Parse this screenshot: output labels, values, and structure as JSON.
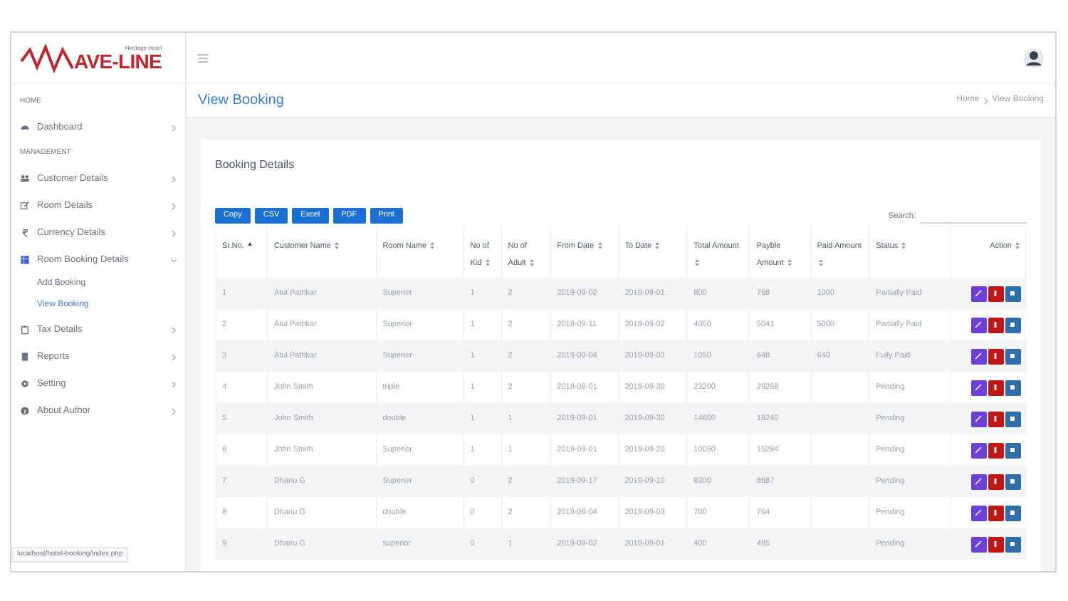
{
  "logo": {
    "text": "AVE-LINE",
    "tagline": "Heritage Hotel"
  },
  "sidebar": {
    "sections": [
      {
        "heading": "HOME",
        "items": [
          {
            "label": "Dashboard",
            "expanded": false
          }
        ]
      },
      {
        "heading": "MANAGEMENT",
        "items": [
          {
            "label": "Customer Details",
            "expanded": false
          },
          {
            "label": "Room Details",
            "expanded": false
          },
          {
            "label": "Currency Details",
            "expanded": false
          },
          {
            "label": "Room Booking Details",
            "expanded": true,
            "children": [
              {
                "label": "Add Booking",
                "selected": false
              },
              {
                "label": "View Booking",
                "selected": true
              }
            ]
          },
          {
            "label": "Tax Details",
            "expanded": false
          },
          {
            "label": "Reports",
            "expanded": false
          },
          {
            "label": "Setting",
            "expanded": false
          },
          {
            "label": "About Author",
            "expanded": false
          }
        ]
      }
    ]
  },
  "page_title": "View Booking",
  "breadcrumb": [
    "Home",
    "View Booking"
  ],
  "status_url": "localhost/hotel-booking/index.php",
  "card": {
    "title": "Booking Details",
    "export_buttons": [
      "Copy",
      "CSV",
      "Excel",
      "PDF",
      "Print"
    ],
    "search_label": "Search:",
    "table": {
      "columns": [
        {
          "label": "Sr.No.",
          "sorted": true
        },
        {
          "label": "Customer Name",
          "sorted": false
        },
        {
          "label": "Room Name",
          "sorted": false
        },
        {
          "label": "No of Kid",
          "sorted": false
        },
        {
          "label": "No of Adult",
          "sorted": false
        },
        {
          "label": "From Date",
          "sorted": false
        },
        {
          "label": "To Date",
          "sorted": false
        },
        {
          "label": "Total Amount",
          "sorted": false
        },
        {
          "label": "Payble Amount",
          "sorted": false
        },
        {
          "label": "Paid Amount",
          "sorted": false
        },
        {
          "label": "Status",
          "sorted": false
        },
        {
          "label": "Action",
          "sorted": false
        }
      ],
      "rows": [
        [
          "1",
          "Atul Pathkar",
          "Superior",
          "1",
          "2",
          "2019-09-02",
          "2019-09-01",
          "800",
          "768",
          "1000",
          "Partially Paid"
        ],
        [
          "2",
          "Atul Pathkar",
          "Superior",
          "1",
          "2",
          "2019-09-11",
          "2019-09-02",
          "4050",
          "5041",
          "5000",
          "Partially Paid"
        ],
        [
          "3",
          "Atul Pathkar",
          "Superior",
          "1",
          "2",
          "2019-09-04",
          "2019-09-03",
          "1050",
          "648",
          "640",
          "Fully Paid"
        ],
        [
          "4",
          "John Smith",
          "triple",
          "1",
          "2",
          "2019-09-01",
          "2019-09-30",
          "23200",
          "29268",
          "",
          "Pending"
        ],
        [
          "5",
          "John Smith",
          "double",
          "1",
          "1",
          "2019-09-01",
          "2019-09-30",
          "14600",
          "18240",
          "",
          "Pending"
        ],
        [
          "6",
          "John Smith",
          "Superior",
          "1",
          "1",
          "2019-09-01",
          "2019-09-20",
          "10050",
          "15284",
          "",
          "Pending"
        ],
        [
          "7",
          "Dhanu G",
          "Superior",
          "0",
          "2",
          "2019-09-17",
          "2019-09-10",
          "8300",
          "8687",
          "",
          "Pending"
        ],
        [
          "8",
          "Dhanu G",
          "double",
          "0",
          "2",
          "2019-09-04",
          "2019-09-03",
          "700",
          "764",
          "",
          "Pending"
        ],
        [
          "9",
          "Dhanu G",
          "superior",
          "0",
          "1",
          "2019-09-02",
          "2019-09-01",
          "400",
          "495",
          "",
          "Pending"
        ]
      ]
    }
  }
}
